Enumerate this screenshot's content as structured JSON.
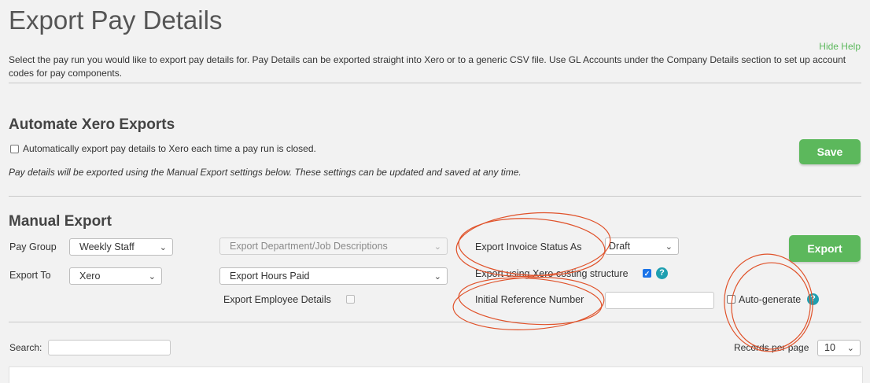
{
  "header": {
    "title": "Export Pay Details",
    "hide_help": "Hide Help",
    "intro": "Select the pay run you would like to export pay details for. Pay Details can be exported straight into Xero or to a generic CSV file. Use GL Accounts under the Company Details section to set up account codes for pay components."
  },
  "automate": {
    "title": "Automate Xero Exports",
    "checkbox_label": "Automatically export pay details to Xero each time a pay run is closed.",
    "checked": false,
    "note": "Pay details will be exported using the Manual Export settings below. These settings can be updated and saved at any time.",
    "save_label": "Save"
  },
  "manual": {
    "title": "Manual Export",
    "pay_group_label": "Pay Group",
    "pay_group_value": "Weekly Staff",
    "export_to_label": "Export To",
    "export_to_value": "Xero",
    "department_select": "Export Department/Job Descriptions",
    "hours_select": "Export Hours Paid",
    "employee_details_label": "Export Employee Details",
    "invoice_status_label": "Export Invoice Status As",
    "invoice_status_value": "Draft",
    "costing_label": "Export using Xero costing structure",
    "costing_checked": true,
    "reference_label": "Initial Reference Number",
    "reference_value": "",
    "auto_generate_label": "Auto-generate",
    "export_button": "Export"
  },
  "table_controls": {
    "search_label": "Search:",
    "search_value": "",
    "records_label": "Records per page",
    "records_value": "10"
  },
  "icons": {
    "help": "help-icon",
    "dropdown": "chevron-down-icon"
  },
  "colors": {
    "accent_green": "#5cb85c",
    "help_teal": "#1e9fb0",
    "annotation_red": "#e0522a"
  }
}
